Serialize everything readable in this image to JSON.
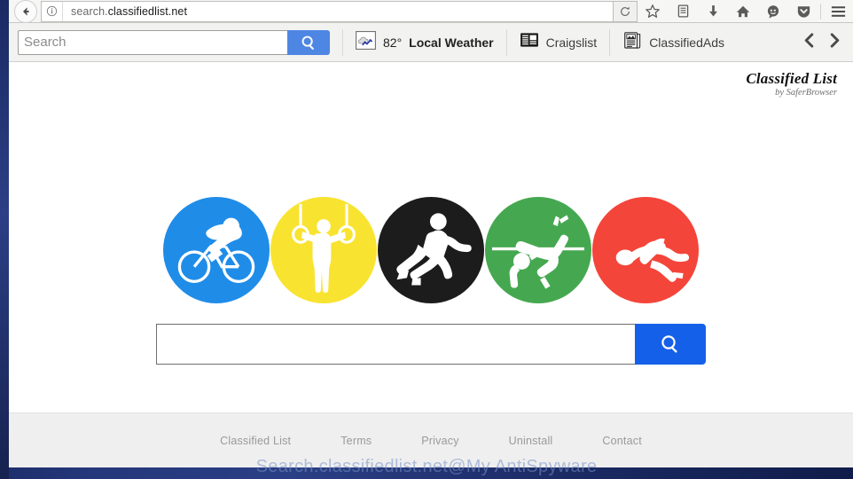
{
  "browser": {
    "back_icon": "back-arrow-icon",
    "info_icon": "info-icon",
    "url_prefix": "search.",
    "url_domain": "classifiedlist.net",
    "url_full": "search.classifiedlist.net",
    "reload_icon": "reload-icon",
    "icons": [
      {
        "name": "bookmark-star-icon",
        "label": "Bookmark"
      },
      {
        "name": "library-icon",
        "label": "Library"
      },
      {
        "name": "downloads-icon",
        "label": "Downloads"
      },
      {
        "name": "home-icon",
        "label": "Home"
      },
      {
        "name": "sync-chat-icon",
        "label": "Messaging"
      },
      {
        "name": "pocket-shield-icon",
        "label": "Pocket"
      },
      {
        "name": "hamburger-menu-icon",
        "label": "Open menu"
      }
    ]
  },
  "toolbar": {
    "search_placeholder": "Search",
    "search_value": "",
    "search_button_icon": "search-icon",
    "items": [
      {
        "name": "weather",
        "icon": "weather-cloud-icon",
        "temperature": "82°",
        "label": "Local Weather"
      },
      {
        "name": "craigslist",
        "icon": "newspaper-icon",
        "label": "Craigslist"
      },
      {
        "name": "classifiedads",
        "icon": "document-image-icon",
        "label": "ClassifiedAds"
      }
    ],
    "prev_icon": "chevron-left-icon",
    "next_icon": "chevron-right-icon"
  },
  "page": {
    "brand_title": "Classified List",
    "brand_subtitle": "by SaferBrowser",
    "circles": [
      {
        "name": "cycling",
        "color": "#1f8ce8",
        "sport": "cyclist-icon"
      },
      {
        "name": "gymnastics",
        "color": "#f9e331",
        "sport": "gymnast-rings-icon"
      },
      {
        "name": "running",
        "color": "#1c1c1c",
        "sport": "runner-icon"
      },
      {
        "name": "high-jump",
        "color": "#45a850",
        "sport": "high-jumper-icon"
      },
      {
        "name": "swimming",
        "color": "#f4453a",
        "sport": "swimmer-icon"
      }
    ],
    "search_value": "",
    "search_placeholder": "",
    "search_button_icon": "search-icon",
    "footer_links": [
      "Classified List",
      "Terms",
      "Privacy",
      "Uninstall",
      "Contact"
    ]
  },
  "watermark": "Search.classifiedlist.net@My AntiSpyware"
}
